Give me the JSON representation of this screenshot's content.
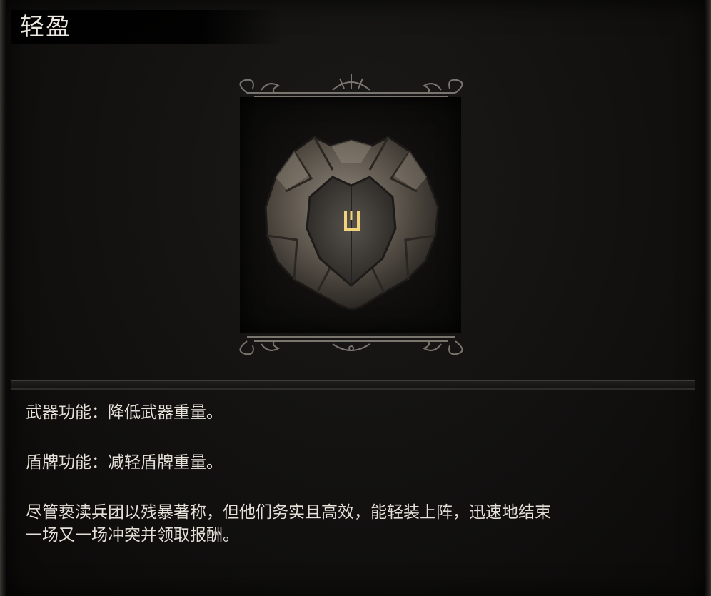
{
  "item": {
    "name": "轻盈",
    "weapon_effect": "武器功能：降低武器重量。",
    "shield_effect": "盾牌功能：减轻盾牌重量。",
    "lore_line1": "尽管亵渎兵团以残暴著称，但他们务实且高效，能轻装上阵，迅速地结束",
    "lore_line2": "一场又一场冲突并领取报酬。",
    "icon": "rune-shield-icon"
  },
  "colors": {
    "background": "#121110",
    "text": "#e6e2da",
    "rune_glow": "#f2d27a",
    "stone": "#6d655a"
  }
}
